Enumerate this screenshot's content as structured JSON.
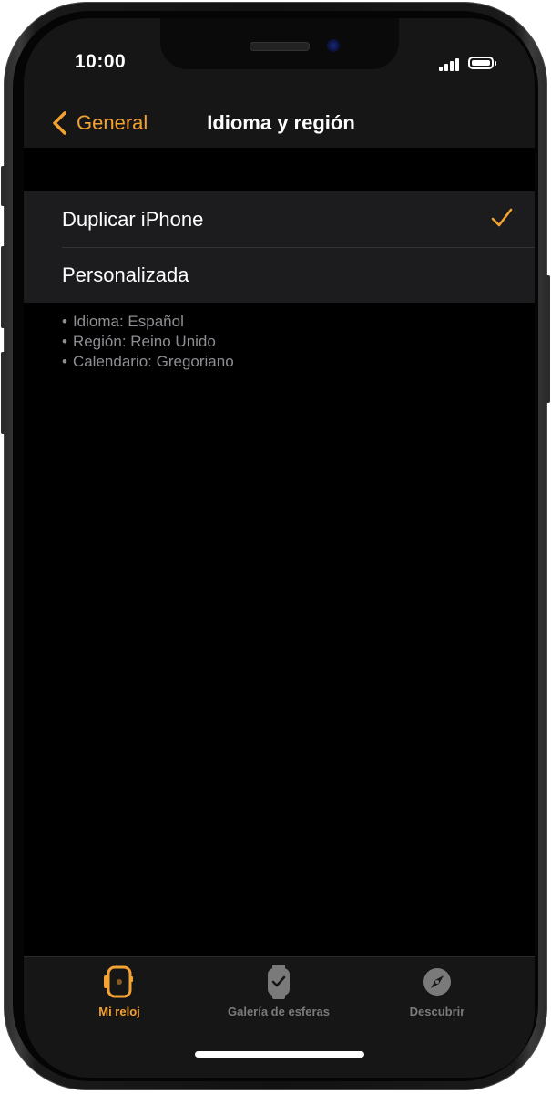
{
  "status_bar": {
    "time": "10:00"
  },
  "nav": {
    "back_label": "General",
    "title": "Idioma y región"
  },
  "options": [
    {
      "label": "Duplicar iPhone",
      "selected": true
    },
    {
      "label": "Personalizada",
      "selected": false
    }
  ],
  "details": [
    "Idioma: Español",
    "Región: Reino Unido",
    "Calendario: Gregoriano"
  ],
  "tabs": [
    {
      "label": "Mi reloj",
      "icon": "watch-icon",
      "active": true
    },
    {
      "label": "Galería de esferas",
      "icon": "watch-face-icon",
      "active": false
    },
    {
      "label": "Descubrir",
      "icon": "compass-icon",
      "active": false
    }
  ],
  "colors": {
    "accent": "#f4a232",
    "background": "#000000",
    "bar_background": "#161616",
    "cell_background": "#1c1c1e",
    "secondary_text": "#8e8e93",
    "inactive_tab": "#7a7a7a"
  }
}
